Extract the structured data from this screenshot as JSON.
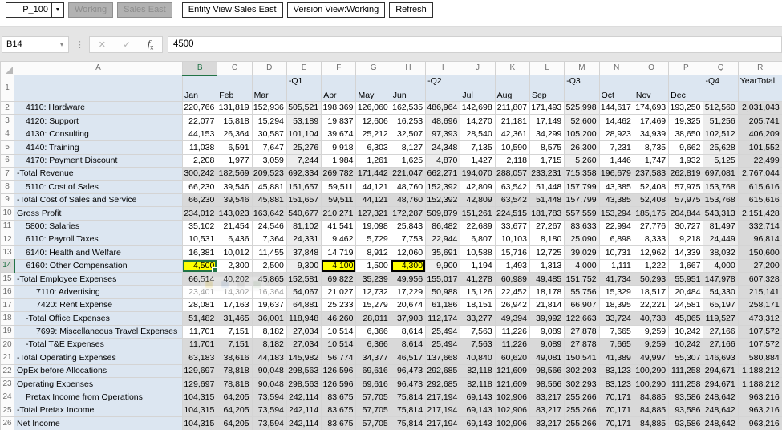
{
  "toolbar": {
    "pov_dropdown": {
      "value": "P_100"
    },
    "working_button": "Working",
    "sales_east_button": "Sales East",
    "entity_view_button": "Entity View:Sales East",
    "version_view_button": "Version View:Working",
    "refresh_button": "Refresh"
  },
  "formula_bar": {
    "name_box": "B14",
    "formula_value": "4500"
  },
  "colors": {
    "member_cell_bg": "#DCE6F1",
    "total_cell_bg": "#D9D9D9",
    "quarter_cell_bg": "#EDEDED",
    "dirty_cell_bg": "#FFFF00",
    "selection_green": "#217346"
  },
  "grid": {
    "selected": {
      "cell": "B14",
      "column": "B",
      "row": 14
    },
    "column_letters": [
      "A",
      "B",
      "C",
      "D",
      "E",
      "F",
      "G",
      "H",
      "I",
      "J",
      "K",
      "L",
      "M",
      "N",
      "O",
      "P",
      "Q",
      "R"
    ],
    "columns": [
      {
        "letter": "B",
        "header": "Jan",
        "header_pos": "bottom",
        "shade": "month"
      },
      {
        "letter": "C",
        "header": "Feb",
        "header_pos": "bottom",
        "shade": "month"
      },
      {
        "letter": "D",
        "header": "Mar",
        "header_pos": "bottom",
        "shade": "month"
      },
      {
        "letter": "E",
        "header": "-Q1",
        "header_pos": "top",
        "shade": "quarter"
      },
      {
        "letter": "F",
        "header": "Apr",
        "header_pos": "bottom",
        "shade": "month"
      },
      {
        "letter": "G",
        "header": "May",
        "header_pos": "bottom",
        "shade": "month"
      },
      {
        "letter": "H",
        "header": "Jun",
        "header_pos": "bottom",
        "shade": "month"
      },
      {
        "letter": "I",
        "header": "-Q2",
        "header_pos": "top",
        "shade": "quarter"
      },
      {
        "letter": "J",
        "header": "Jul",
        "header_pos": "bottom",
        "shade": "month"
      },
      {
        "letter": "K",
        "header": "Aug",
        "header_pos": "bottom",
        "shade": "month"
      },
      {
        "letter": "L",
        "header": "Sep",
        "header_pos": "bottom",
        "shade": "month"
      },
      {
        "letter": "M",
        "header": "-Q3",
        "header_pos": "top",
        "shade": "quarter"
      },
      {
        "letter": "N",
        "header": "Oct",
        "header_pos": "bottom",
        "shade": "month"
      },
      {
        "letter": "O",
        "header": "Nov",
        "header_pos": "bottom",
        "shade": "month"
      },
      {
        "letter": "P",
        "header": "Dec",
        "header_pos": "bottom",
        "shade": "month"
      },
      {
        "letter": "Q",
        "header": "-Q4",
        "header_pos": "top",
        "shade": "quarter"
      },
      {
        "letter": "R",
        "header": "YearTotal",
        "header_pos": "top",
        "shade": "total"
      }
    ],
    "rows": [
      {
        "num": 2,
        "label": "4110: Hardware",
        "indent": 1,
        "total": false,
        "values": [
          "220,766",
          "131,819",
          "152,936",
          "505,521",
          "198,369",
          "126,060",
          "162,535",
          "486,964",
          "142,698",
          "211,807",
          "171,493",
          "525,998",
          "144,617",
          "174,693",
          "193,250",
          "512,560",
          "2,031,043"
        ]
      },
      {
        "num": 3,
        "label": "4120: Support",
        "indent": 1,
        "total": false,
        "values": [
          "22,077",
          "15,818",
          "15,294",
          "53,189",
          "19,837",
          "12,606",
          "16,253",
          "48,696",
          "14,270",
          "21,181",
          "17,149",
          "52,600",
          "14,462",
          "17,469",
          "19,325",
          "51,256",
          "205,741"
        ]
      },
      {
        "num": 4,
        "label": "4130: Consulting",
        "indent": 1,
        "total": false,
        "values": [
          "44,153",
          "26,364",
          "30,587",
          "101,104",
          "39,674",
          "25,212",
          "32,507",
          "97,393",
          "28,540",
          "42,361",
          "34,299",
          "105,200",
          "28,923",
          "34,939",
          "38,650",
          "102,512",
          "406,209"
        ]
      },
      {
        "num": 5,
        "label": "4140: Training",
        "indent": 1,
        "total": false,
        "values": [
          "11,038",
          "6,591",
          "7,647",
          "25,276",
          "9,918",
          "6,303",
          "8,127",
          "24,348",
          "7,135",
          "10,590",
          "8,575",
          "26,300",
          "7,231",
          "8,735",
          "9,662",
          "25,628",
          "101,552"
        ]
      },
      {
        "num": 6,
        "label": "4170: Payment Discount",
        "indent": 1,
        "total": false,
        "values": [
          "2,208",
          "1,977",
          "3,059",
          "7,244",
          "1,984",
          "1,261",
          "1,625",
          "4,870",
          "1,427",
          "2,118",
          "1,715",
          "5,260",
          "1,446",
          "1,747",
          "1,932",
          "5,125",
          "22,499"
        ]
      },
      {
        "num": 7,
        "label": "-Total Revenue",
        "indent": 0,
        "total": true,
        "values": [
          "300,242",
          "182,569",
          "209,523",
          "692,334",
          "269,782",
          "171,442",
          "221,047",
          "662,271",
          "194,070",
          "288,057",
          "233,231",
          "715,358",
          "196,679",
          "237,583",
          "262,819",
          "697,081",
          "2,767,044"
        ]
      },
      {
        "num": 8,
        "label": "5110: Cost of Sales",
        "indent": 1,
        "total": false,
        "values": [
          "66,230",
          "39,546",
          "45,881",
          "151,657",
          "59,511",
          "44,121",
          "48,760",
          "152,392",
          "42,809",
          "63,542",
          "51,448",
          "157,799",
          "43,385",
          "52,408",
          "57,975",
          "153,768",
          "615,616"
        ]
      },
      {
        "num": 9,
        "label": "-Total Cost of Sales and Service",
        "indent": 0,
        "total": true,
        "values": [
          "66,230",
          "39,546",
          "45,881",
          "151,657",
          "59,511",
          "44,121",
          "48,760",
          "152,392",
          "42,809",
          "63,542",
          "51,448",
          "157,799",
          "43,385",
          "52,408",
          "57,975",
          "153,768",
          "615,616"
        ]
      },
      {
        "num": 10,
        "label": "Gross Profit",
        "indent": 0,
        "total": true,
        "values": [
          "234,012",
          "143,023",
          "163,642",
          "540,677",
          "210,271",
          "127,321",
          "172,287",
          "509,879",
          "151,261",
          "224,515",
          "181,783",
          "557,559",
          "153,294",
          "185,175",
          "204,844",
          "543,313",
          "2,151,428"
        ]
      },
      {
        "num": 11,
        "label": "5800: Salaries",
        "indent": 1,
        "total": false,
        "values": [
          "35,102",
          "21,454",
          "24,546",
          "81,102",
          "41,541",
          "19,098",
          "25,843",
          "86,482",
          "22,689",
          "33,677",
          "27,267",
          "83,633",
          "22,994",
          "27,776",
          "30,727",
          "81,497",
          "332,714"
        ]
      },
      {
        "num": 12,
        "label": "6110: Payroll Taxes",
        "indent": 1,
        "total": false,
        "values": [
          "10,531",
          "6,436",
          "7,364",
          "24,331",
          "9,462",
          "5,729",
          "7,753",
          "22,944",
          "6,807",
          "10,103",
          "8,180",
          "25,090",
          "6,898",
          "8,333",
          "9,218",
          "24,449",
          "96,814"
        ]
      },
      {
        "num": 13,
        "label": "6140: Health and Welfare",
        "indent": 1,
        "total": false,
        "values": [
          "16,381",
          "10,012",
          "11,455",
          "37,848",
          "14,719",
          "8,912",
          "12,060",
          "35,691",
          "10,588",
          "15,716",
          "12,725",
          "39,029",
          "10,731",
          "12,962",
          "14,339",
          "38,032",
          "150,600"
        ]
      },
      {
        "num": 14,
        "label": "6160: Other Compensation",
        "indent": 1,
        "total": false,
        "marks": {
          "B": "dirty-selected",
          "F": "dirty",
          "H": "dirty"
        },
        "values": [
          "4,500",
          "2,300",
          "2,500",
          "9,300",
          "4,100",
          "1,500",
          "4,300",
          "9,900",
          "1,194",
          "1,493",
          "1,313",
          "4,000",
          "1,111",
          "1,222",
          "1,667",
          "4,000",
          "27,200"
        ]
      },
      {
        "num": 15,
        "label": "-Total Employee Expenses",
        "indent": 0,
        "total": true,
        "values": [
          "66,514",
          "40,202",
          "45,865",
          "152,581",
          "69,822",
          "35,239",
          "49,956",
          "155,017",
          "41,278",
          "60,989",
          "49,485",
          "151,752",
          "41,734",
          "50,293",
          "55,951",
          "147,978",
          "607,328"
        ]
      },
      {
        "num": 16,
        "label": "7110: Advertising",
        "indent": 2,
        "total": false,
        "marks": {
          "B": "faded",
          "C": "faded",
          "D": "faded"
        },
        "values": [
          "23,401",
          "14,302",
          "16,364",
          "54,067",
          "21,027",
          "12,732",
          "17,229",
          "50,988",
          "15,126",
          "22,452",
          "18,178",
          "55,756",
          "15,329",
          "18,517",
          "20,484",
          "54,330",
          "215,141"
        ]
      },
      {
        "num": 17,
        "label": "7420: Rent Expense",
        "indent": 2,
        "total": false,
        "values": [
          "28,081",
          "17,163",
          "19,637",
          "64,881",
          "25,233",
          "15,279",
          "20,674",
          "61,186",
          "18,151",
          "26,942",
          "21,814",
          "66,907",
          "18,395",
          "22,221",
          "24,581",
          "65,197",
          "258,171"
        ]
      },
      {
        "num": 18,
        "label": "-Total Office Expenses",
        "indent": 1,
        "total": true,
        "values": [
          "51,482",
          "31,465",
          "36,001",
          "118,948",
          "46,260",
          "28,011",
          "37,903",
          "112,174",
          "33,277",
          "49,394",
          "39,992",
          "122,663",
          "33,724",
          "40,738",
          "45,065",
          "119,527",
          "473,312"
        ]
      },
      {
        "num": 19,
        "label": "7699: Miscellaneous Travel Expenses",
        "indent": 2,
        "total": false,
        "values": [
          "11,701",
          "7,151",
          "8,182",
          "27,034",
          "10,514",
          "6,366",
          "8,614",
          "25,494",
          "7,563",
          "11,226",
          "9,089",
          "27,878",
          "7,665",
          "9,259",
          "10,242",
          "27,166",
          "107,572"
        ]
      },
      {
        "num": 20,
        "label": "-Total T&E Expenses",
        "indent": 1,
        "total": true,
        "values": [
          "11,701",
          "7,151",
          "8,182",
          "27,034",
          "10,514",
          "6,366",
          "8,614",
          "25,494",
          "7,563",
          "11,226",
          "9,089",
          "27,878",
          "7,665",
          "9,259",
          "10,242",
          "27,166",
          "107,572"
        ]
      },
      {
        "num": 21,
        "label": "-Total Operating Expenses",
        "indent": 0,
        "total": true,
        "values": [
          "63,183",
          "38,616",
          "44,183",
          "145,982",
          "56,774",
          "34,377",
          "46,517",
          "137,668",
          "40,840",
          "60,620",
          "49,081",
          "150,541",
          "41,389",
          "49,997",
          "55,307",
          "146,693",
          "580,884"
        ]
      },
      {
        "num": 22,
        "label": "OpEx before Allocations",
        "indent": 0,
        "total": true,
        "values": [
          "129,697",
          "78,818",
          "90,048",
          "298,563",
          "126,596",
          "69,616",
          "96,473",
          "292,685",
          "82,118",
          "121,609",
          "98,566",
          "302,293",
          "83,123",
          "100,290",
          "111,258",
          "294,671",
          "1,188,212"
        ]
      },
      {
        "num": 23,
        "label": "Operating Expenses",
        "indent": 0,
        "total": true,
        "values": [
          "129,697",
          "78,818",
          "90,048",
          "298,563",
          "126,596",
          "69,616",
          "96,473",
          "292,685",
          "82,118",
          "121,609",
          "98,566",
          "302,293",
          "83,123",
          "100,290",
          "111,258",
          "294,671",
          "1,188,212"
        ]
      },
      {
        "num": 24,
        "label": "Pretax Income from Operations",
        "indent": 1,
        "total": true,
        "values": [
          "104,315",
          "64,205",
          "73,594",
          "242,114",
          "83,675",
          "57,705",
          "75,814",
          "217,194",
          "69,143",
          "102,906",
          "83,217",
          "255,266",
          "70,171",
          "84,885",
          "93,586",
          "248,642",
          "963,216"
        ]
      },
      {
        "num": 25,
        "label": "-Total Pretax Income",
        "indent": 0,
        "total": true,
        "values": [
          "104,315",
          "64,205",
          "73,594",
          "242,114",
          "83,675",
          "57,705",
          "75,814",
          "217,194",
          "69,143",
          "102,906",
          "83,217",
          "255,266",
          "70,171",
          "84,885",
          "93,586",
          "248,642",
          "963,216"
        ]
      },
      {
        "num": 26,
        "label": "Net Income",
        "indent": 0,
        "total": true,
        "values": [
          "104,315",
          "64,205",
          "73,594",
          "242,114",
          "83,675",
          "57,705",
          "75,814",
          "217,194",
          "69,143",
          "102,906",
          "83,217",
          "255,266",
          "70,171",
          "84,885",
          "93,586",
          "248,642",
          "963,216"
        ]
      }
    ]
  }
}
